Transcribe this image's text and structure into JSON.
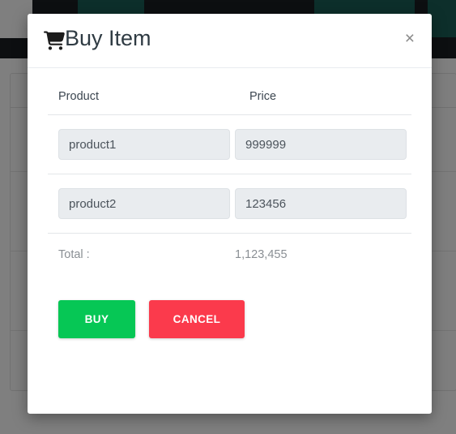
{
  "background": {
    "name": "dimmed-application-page",
    "navbar_color": "#1b1f22",
    "accent_button_color": "#1b5f57",
    "scrim_color": "#808080"
  },
  "modal": {
    "title": "Buy Item",
    "title_icon": "shopping-cart-icon",
    "close_label": "×",
    "columns": {
      "product": "Product",
      "price": "Price"
    },
    "rows": [
      {
        "product": "product1",
        "price": "999999"
      },
      {
        "product": "product2",
        "price": "123456"
      }
    ],
    "total": {
      "label": "Total :",
      "value": "1,123,455"
    },
    "actions": {
      "buy": "BUY",
      "cancel": "CANCEL"
    },
    "colors": {
      "buy": "#06c755",
      "cancel": "#fb3a4c",
      "input_background": "#e9ecef",
      "title": "#2f3b43"
    }
  }
}
